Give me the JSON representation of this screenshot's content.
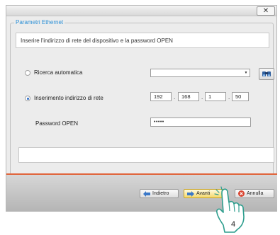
{
  "window": {
    "close_label": "✕"
  },
  "group": {
    "legend": "Parametri Ethernet"
  },
  "instruction": "Inserire l'indirizzo di rete del dispositivo e la password OPEN",
  "options": {
    "auto": {
      "label": "Ricerca automatica",
      "selected": false
    },
    "manual": {
      "label": "Inserimento indirizzo di rete",
      "selected": true
    }
  },
  "auto_combo": {
    "value": ""
  },
  "ip_address": {
    "octet1": "192",
    "octet2": "168",
    "octet3": "1",
    "octet4": "50"
  },
  "password": {
    "label": "Password OPEN",
    "value": "•••••"
  },
  "buttons": {
    "back": "Indietro",
    "next": "Avanti",
    "cancel": "Annulla"
  },
  "callout": {
    "step": "4"
  },
  "colors": {
    "legend": "#2a8fd6",
    "footer_accent": "#e0643a",
    "primary_button": "#f5d86c",
    "cancel_icon": "#d9432f"
  },
  "icons": {
    "search": "binoculars-icon",
    "back": "arrow-left-icon",
    "next": "arrow-right-icon",
    "cancel": "cancel-icon",
    "pointer": "hand-pointer-icon"
  }
}
